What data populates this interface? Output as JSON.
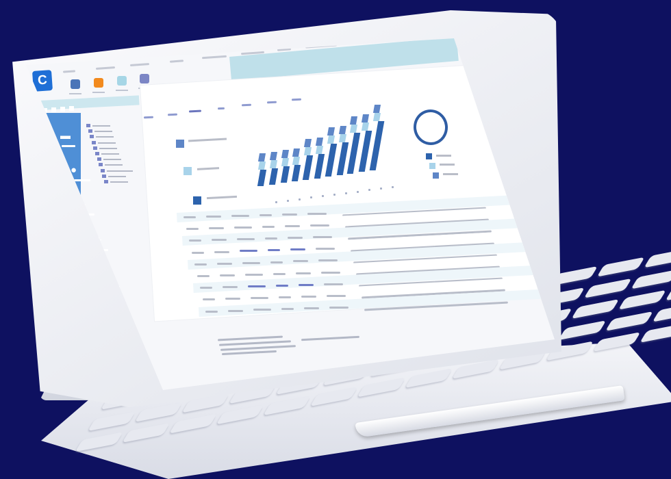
{
  "app": {
    "logo_letter": "C",
    "brand_color": "#1f6fd6"
  },
  "ribbon": {
    "dots": "▮▮▮▮"
  },
  "toolbar": {
    "buttons": [
      {
        "icon": "document-icon",
        "color": "#4a74b8"
      },
      {
        "icon": "folder-icon",
        "color": "#f28a1e"
      },
      {
        "icon": "file-icon",
        "color": "#a6d6e6"
      },
      {
        "icon": "report-icon",
        "color": "#7c86c5"
      }
    ]
  },
  "sidebar": {
    "items": [
      {
        "icon": "monitor-icon",
        "glyph": "▬"
      },
      {
        "icon": "user-icon",
        "glyph": "👤"
      },
      {
        "icon": "folder-icon",
        "glyph": "▪"
      },
      {
        "icon": "scatter-icon",
        "glyph": "⁘"
      },
      {
        "icon": "bar-chart-icon",
        "glyph": "▙"
      },
      {
        "icon": "circle-icon",
        "glyph": "●"
      },
      {
        "icon": "folder-icon",
        "glyph": "▪"
      }
    ],
    "accent_color": "#f5a21b"
  },
  "chart_data": {
    "type": "bar",
    "title": "",
    "categories": [
      "",
      "",
      "",
      "",
      "",
      "",
      "",
      "",
      "",
      "",
      ""
    ],
    "series": [
      {
        "color": "#2d63ad",
        "values": [
          2,
          2,
          2,
          2,
          3,
          3,
          4,
          4,
          5,
          5,
          6
        ]
      },
      {
        "color": "#a8d3ea",
        "values": [
          1,
          1,
          1,
          1,
          1,
          1,
          1,
          1,
          1,
          1,
          1
        ]
      },
      {
        "color": "#5e86c7",
        "values": [
          1,
          1,
          1,
          1,
          1,
          1,
          1,
          1,
          1,
          1,
          1
        ]
      }
    ]
  },
  "legend": {
    "swatches": [
      "#5e86c7",
      "#a8d3ea",
      "#2d63ad"
    ]
  },
  "donut": {
    "color": "#2f5da4"
  }
}
